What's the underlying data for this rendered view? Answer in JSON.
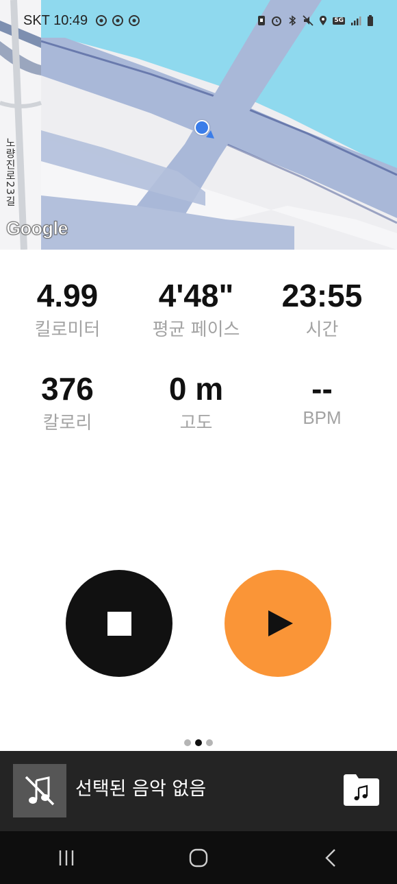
{
  "status_bar": {
    "carrier_time": "SKT 10:49",
    "network_badge": "5G",
    "icons_left": [
      "chrome-icon",
      "chrome-icon",
      "chrome-icon"
    ],
    "icons_right": [
      "sim-icon",
      "alarm-icon",
      "bluetooth-icon",
      "mute-icon",
      "location-icon",
      "5g-icon",
      "signal-icon",
      "battery-icon"
    ]
  },
  "map": {
    "street_label": "노량진로23길",
    "google_logo": "Google",
    "colors": {
      "water": "#8fd9ee",
      "road": "#a6b6d6",
      "land": "#f3f3f5"
    }
  },
  "stats": [
    {
      "value": "4.99",
      "label": "킬로미터"
    },
    {
      "value": "4'48\"",
      "label": "평균 페이스"
    },
    {
      "value": "23:55",
      "label": "시간"
    },
    {
      "value": "376",
      "label": "칼로리"
    },
    {
      "value": "0 m",
      "label": "고도"
    },
    {
      "value": "--",
      "label": "BPM"
    }
  ],
  "controls": {
    "stop_icon": "stop-icon",
    "play_icon": "play-icon",
    "stop_color": "#111111",
    "play_color": "#fa9537"
  },
  "pager": {
    "page_count": 3,
    "active_index": 1
  },
  "music": {
    "status_text": "선택된 음악 없음",
    "thumb_icon": "music-off-icon",
    "action_icon": "music-folder-icon"
  },
  "nav_bar": {
    "icons": [
      "recent-apps-icon",
      "home-icon",
      "back-icon"
    ]
  }
}
